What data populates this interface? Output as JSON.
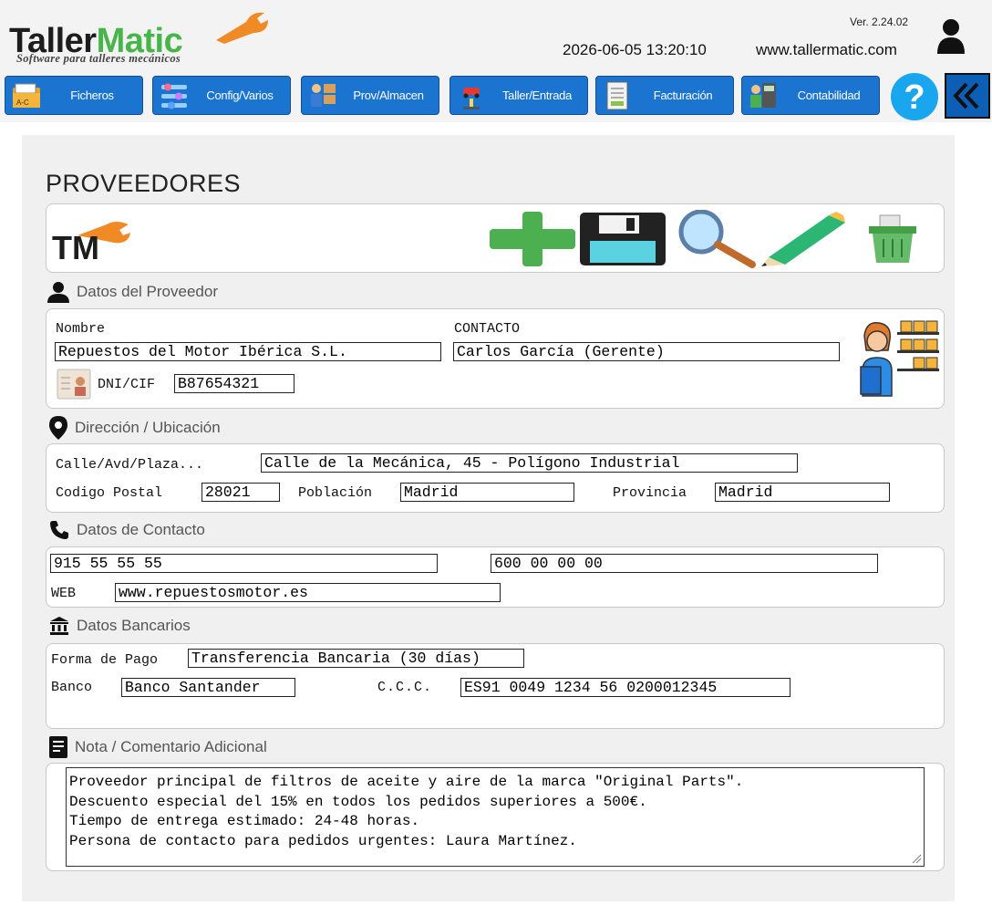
{
  "app": {
    "logo_main": "Taller",
    "logo_accent": "Matic",
    "logo_tagline": "Software para talleres mecánicos",
    "version": "Ver. 2.24.02",
    "datetime": "2026-06-05 13:20:10",
    "website": "www.tallermatic.com"
  },
  "nav": {
    "items": [
      {
        "label": "Ficheros",
        "icon": "folder-icon"
      },
      {
        "label": "Config/Varios",
        "icon": "settings-sliders-icon"
      },
      {
        "label": "Prov/Almacen",
        "icon": "warehouse-worker-icon"
      },
      {
        "label": "Taller/Entrada",
        "icon": "car-lift-icon"
      },
      {
        "label": "Facturación",
        "icon": "invoice-icon"
      },
      {
        "label": "Contabilidad",
        "icon": "calculator-icon"
      }
    ],
    "help_icon": "help-icon",
    "collapse_icon": "double-chevron-left-icon"
  },
  "page": {
    "title": "PROVEEDORES",
    "toolbar_logo": "TM",
    "toolbar_actions": [
      "add-icon",
      "save-icon",
      "search-icon",
      "edit-icon",
      "delete-icon"
    ]
  },
  "supplier": {
    "section": "Datos del Proveedor",
    "name_label": "Nombre",
    "name": "Repuestos del Motor Ibérica S.L.",
    "contact_label": "CONTACTO",
    "contact": "Carlos García (Gerente)",
    "dni_label": "DNI/CIF",
    "dni": "B87654321"
  },
  "address": {
    "section": "Dirección / Ubicación",
    "street_label": "Calle/Avd/Plaza...",
    "street": "Calle de la Mecánica, 45 - Polígono Industrial",
    "zip_label": "Codigo Postal",
    "zip": "28021",
    "city_label": "Población",
    "city": "Madrid",
    "province_label": "Provincia",
    "province": "Madrid"
  },
  "contact": {
    "section": "Datos de Contacto",
    "phone1": "915 55 55 55",
    "phone2": "600 00 00 00",
    "web_label": "WEB",
    "web": "www.repuestosmotor.es"
  },
  "bank": {
    "section": "Datos Bancarios",
    "payment_label": "Forma de Pago",
    "payment": "Transferencia Bancaria (30 días)",
    "bank_label": "Banco",
    "bank": "Banco Santander",
    "ccc_label": "C.C.C.",
    "ccc": "ES91 0049 1234 56 0200012345"
  },
  "note": {
    "section": "Nota / Comentario Adicional",
    "text": "Proveedor principal de filtros de aceite y aire de la marca \"Original Parts\".\nDescuento especial del 15% en todos los pedidos superiores a 500€.\nTiempo de entrega estimado: 24-48 horas.\nPersona de contacto para pedidos urgentes: Laura Martínez."
  },
  "colors": {
    "nav_blue": "#1b74d0",
    "accent_green": "#48b54a",
    "accent_orange": "#f08a24",
    "panel_bg": "#f0f0f0"
  }
}
